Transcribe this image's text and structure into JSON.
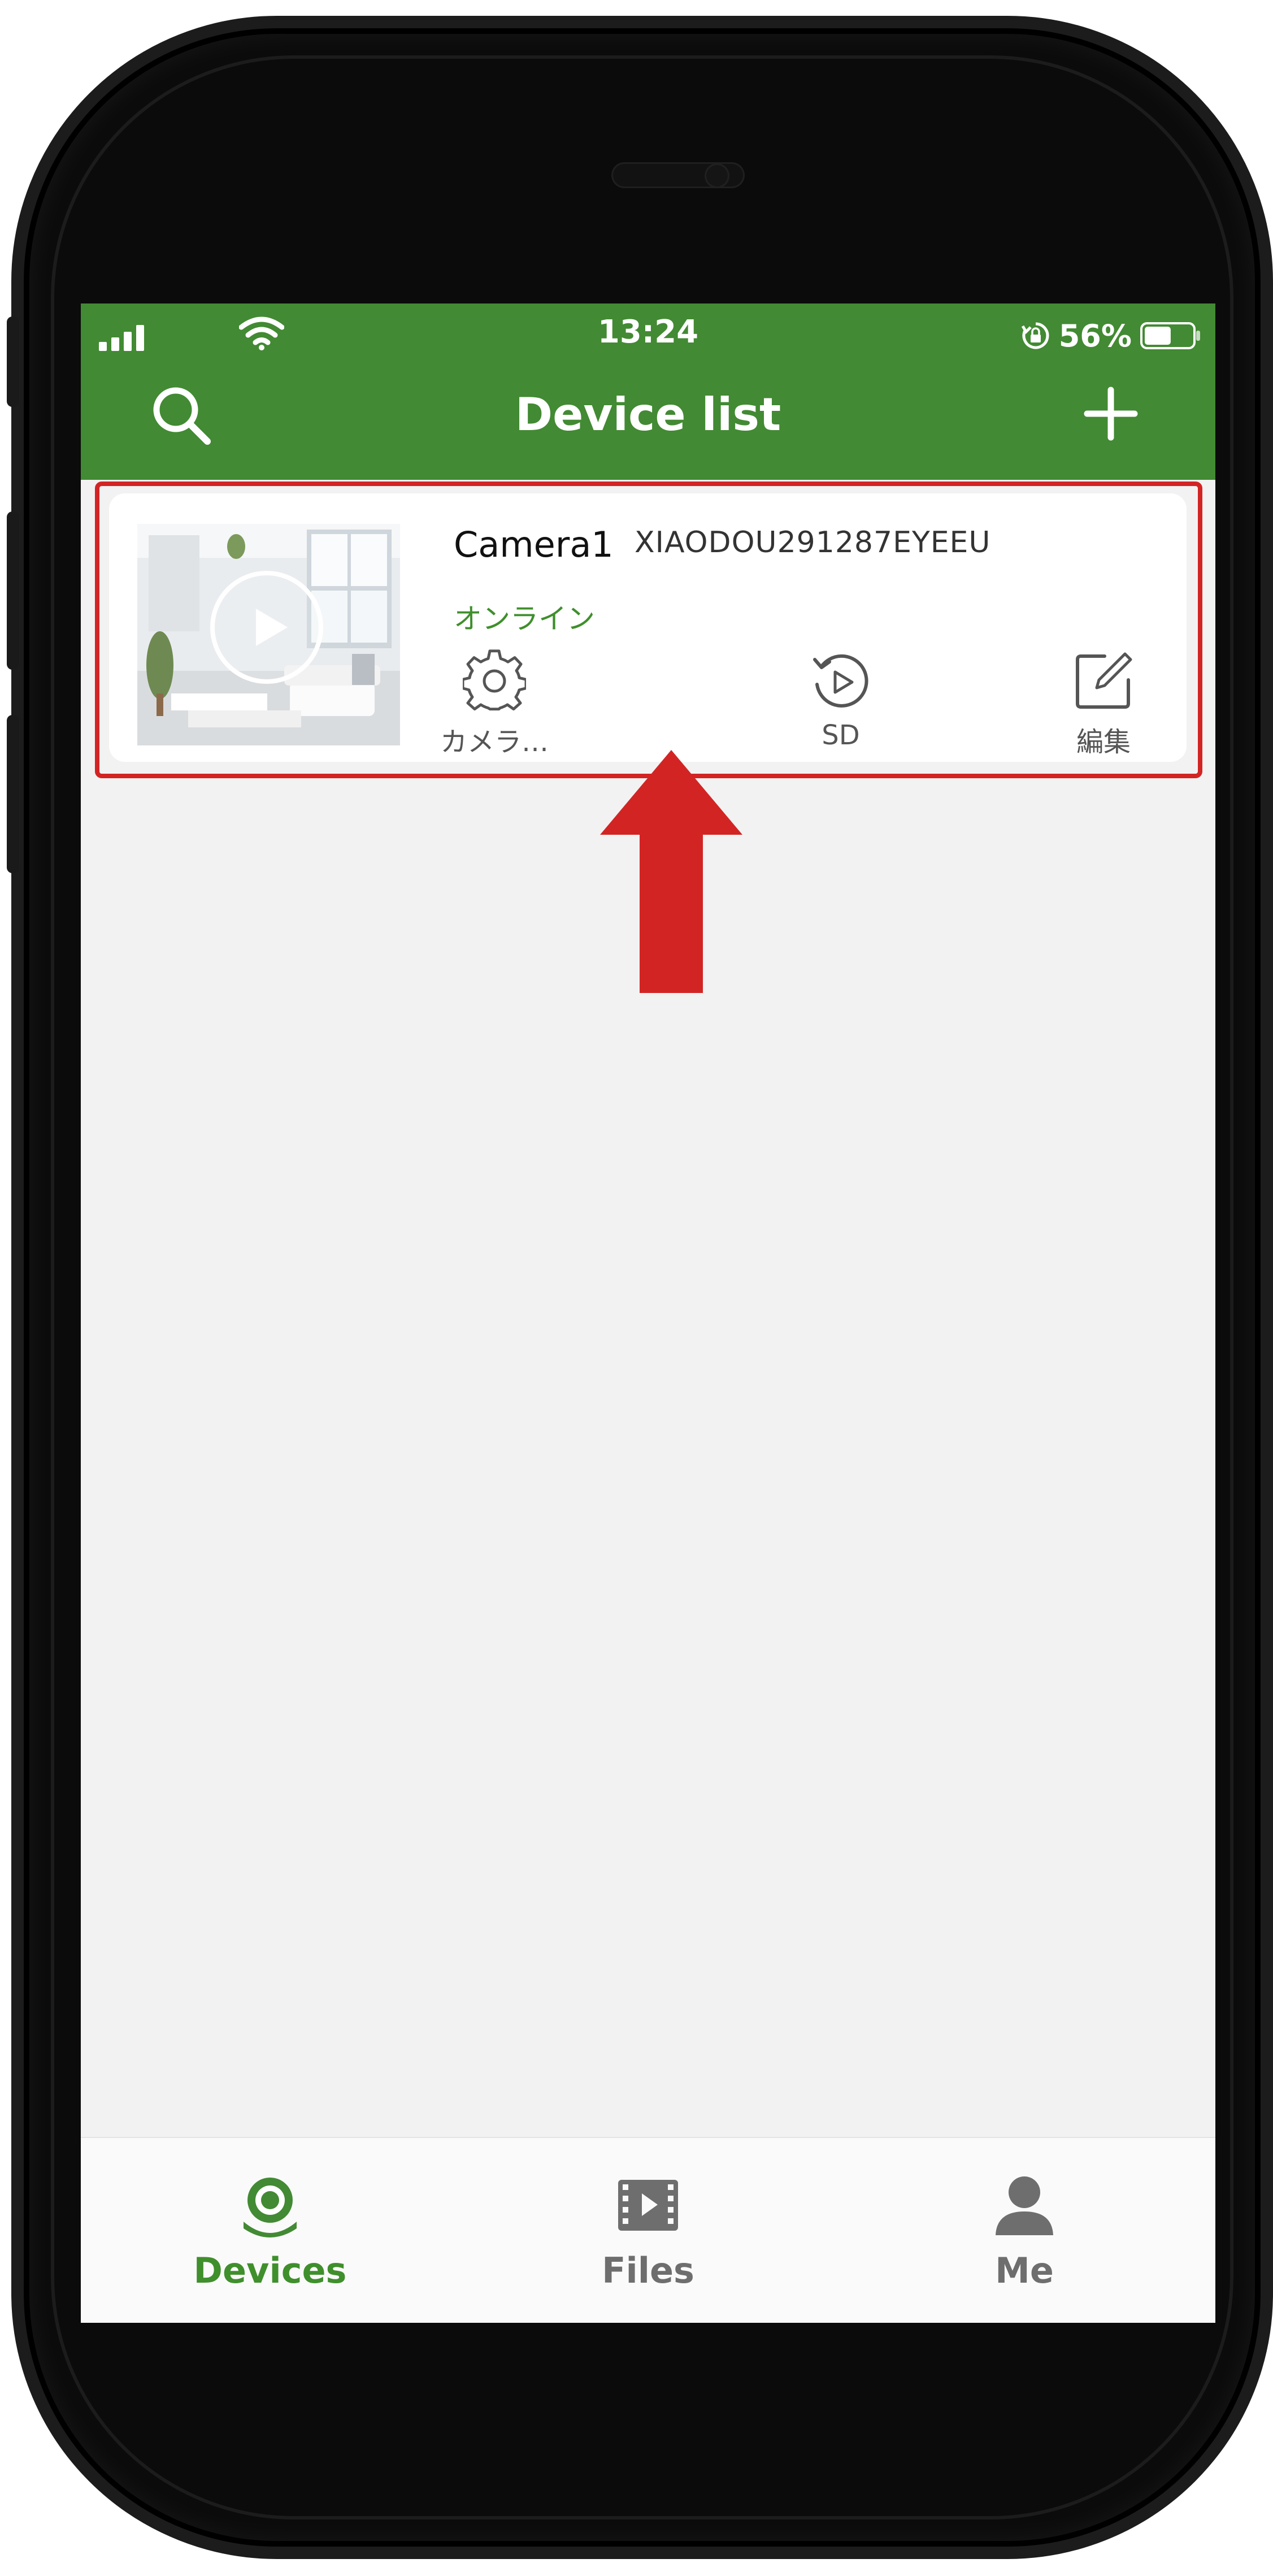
{
  "status_bar": {
    "time": "13:24",
    "battery_percent": "56%",
    "battery_level": 0.56
  },
  "header": {
    "title": "Device list",
    "search_icon": "search-icon",
    "add_icon": "plus-icon"
  },
  "device": {
    "name": "Camera1",
    "id": "XIAODOU291287EYEEU",
    "status": "オンライン",
    "actions": [
      {
        "label": "カメラ…",
        "icon": "gear-icon"
      },
      {
        "label": "SD",
        "icon": "playback-icon"
      },
      {
        "label": "編集",
        "icon": "edit-icon"
      }
    ]
  },
  "tabs": [
    {
      "label": "Devices",
      "icon": "camera-icon",
      "active": true
    },
    {
      "label": "Files",
      "icon": "film-icon",
      "active": false
    },
    {
      "label": "Me",
      "icon": "person-icon",
      "active": false
    }
  ],
  "colors": {
    "brand_green": "#428a33",
    "status_green": "#3f8f2c",
    "annotation_red": "#d32424",
    "inactive_tab": "#6e6e6e"
  }
}
